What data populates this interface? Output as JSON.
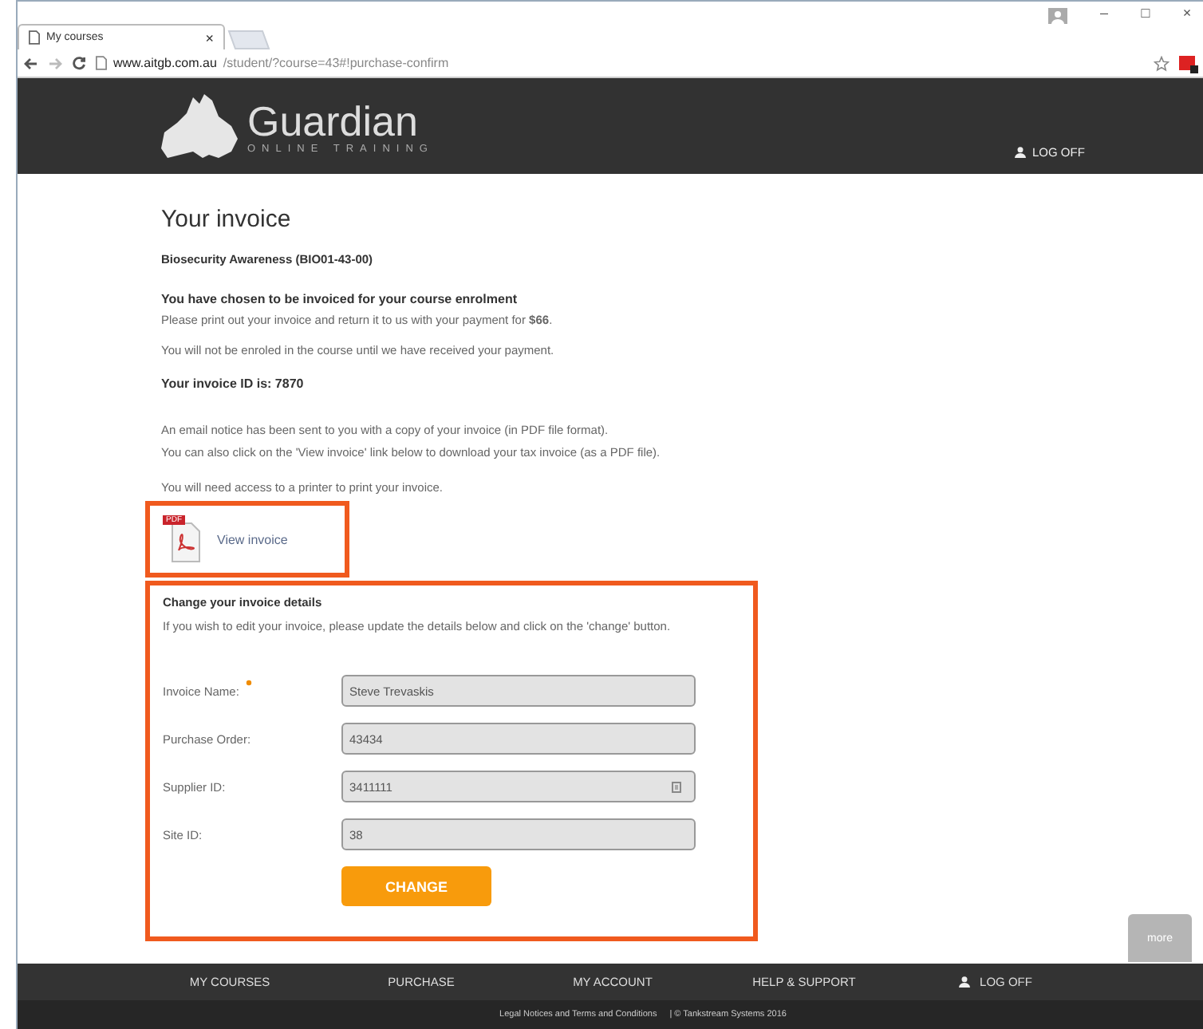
{
  "browser": {
    "tab_title": "My courses",
    "tab_close": "×",
    "url_host": "www.aitgb.com.au",
    "url_path": "/student/?course=43#!purchase-confirm",
    "window_controls": [
      "–",
      "□",
      "×"
    ]
  },
  "header": {
    "brand": "Guardian",
    "tagline": "ONLINE TRAINING",
    "logoff": "LOG OFF"
  },
  "invoice": {
    "title": "Your invoice",
    "course": "Biosecurity Awareness (BIO01-43-00)",
    "heading": "You have chosen to be invoiced for your course enrolment",
    "payment_text": "Please print out your invoice and return it to us with your payment for **$66**.",
    "notice": "You will not be enroled in the course until we have received your payment.",
    "invoice_id": "Your invoice ID is: 7870",
    "email_lines": [
      "An email notice has been sent to you with a copy of your invoice (in PDF file format).",
      "You can also click on the 'View invoice' link below to download your tax invoice (as a PDF file)."
    ],
    "printer_note": "You will need access to a printer to print your invoice.",
    "pdf_badge": "PDF",
    "view_invoice": "View invoice"
  },
  "details": {
    "heading": "Change your invoice details",
    "intro": "If you wish to edit your invoice, please update the details below and click on the 'change' button.",
    "fields": [
      {
        "label": "Invoice Name:",
        "value": "Steve Trevaskis",
        "required": true,
        "kind": "text"
      },
      {
        "label": "Purchase Order:",
        "value": "43434",
        "required": false,
        "kind": "text"
      },
      {
        "label": "Supplier ID:",
        "value": "3411111",
        "required": false,
        "kind": "lookup"
      },
      {
        "label": "Site ID:",
        "value": "38",
        "required": false,
        "kind": "text"
      }
    ],
    "button": "CHANGE"
  },
  "more_button": "more",
  "footer": {
    "nav": [
      {
        "label": "MY COURSES",
        "kind": "link"
      },
      {
        "label": "PURCHASE",
        "kind": "link"
      },
      {
        "label": "MY ACCOUNT",
        "kind": "link"
      },
      {
        "label": "HELP & SUPPORT",
        "kind": "link"
      },
      {
        "label": "LOG OFF",
        "kind": "user"
      }
    ],
    "legal": "Legal Notices and Terms and Conditions",
    "copyright": "| © Tankstream Systems 2016"
  }
}
